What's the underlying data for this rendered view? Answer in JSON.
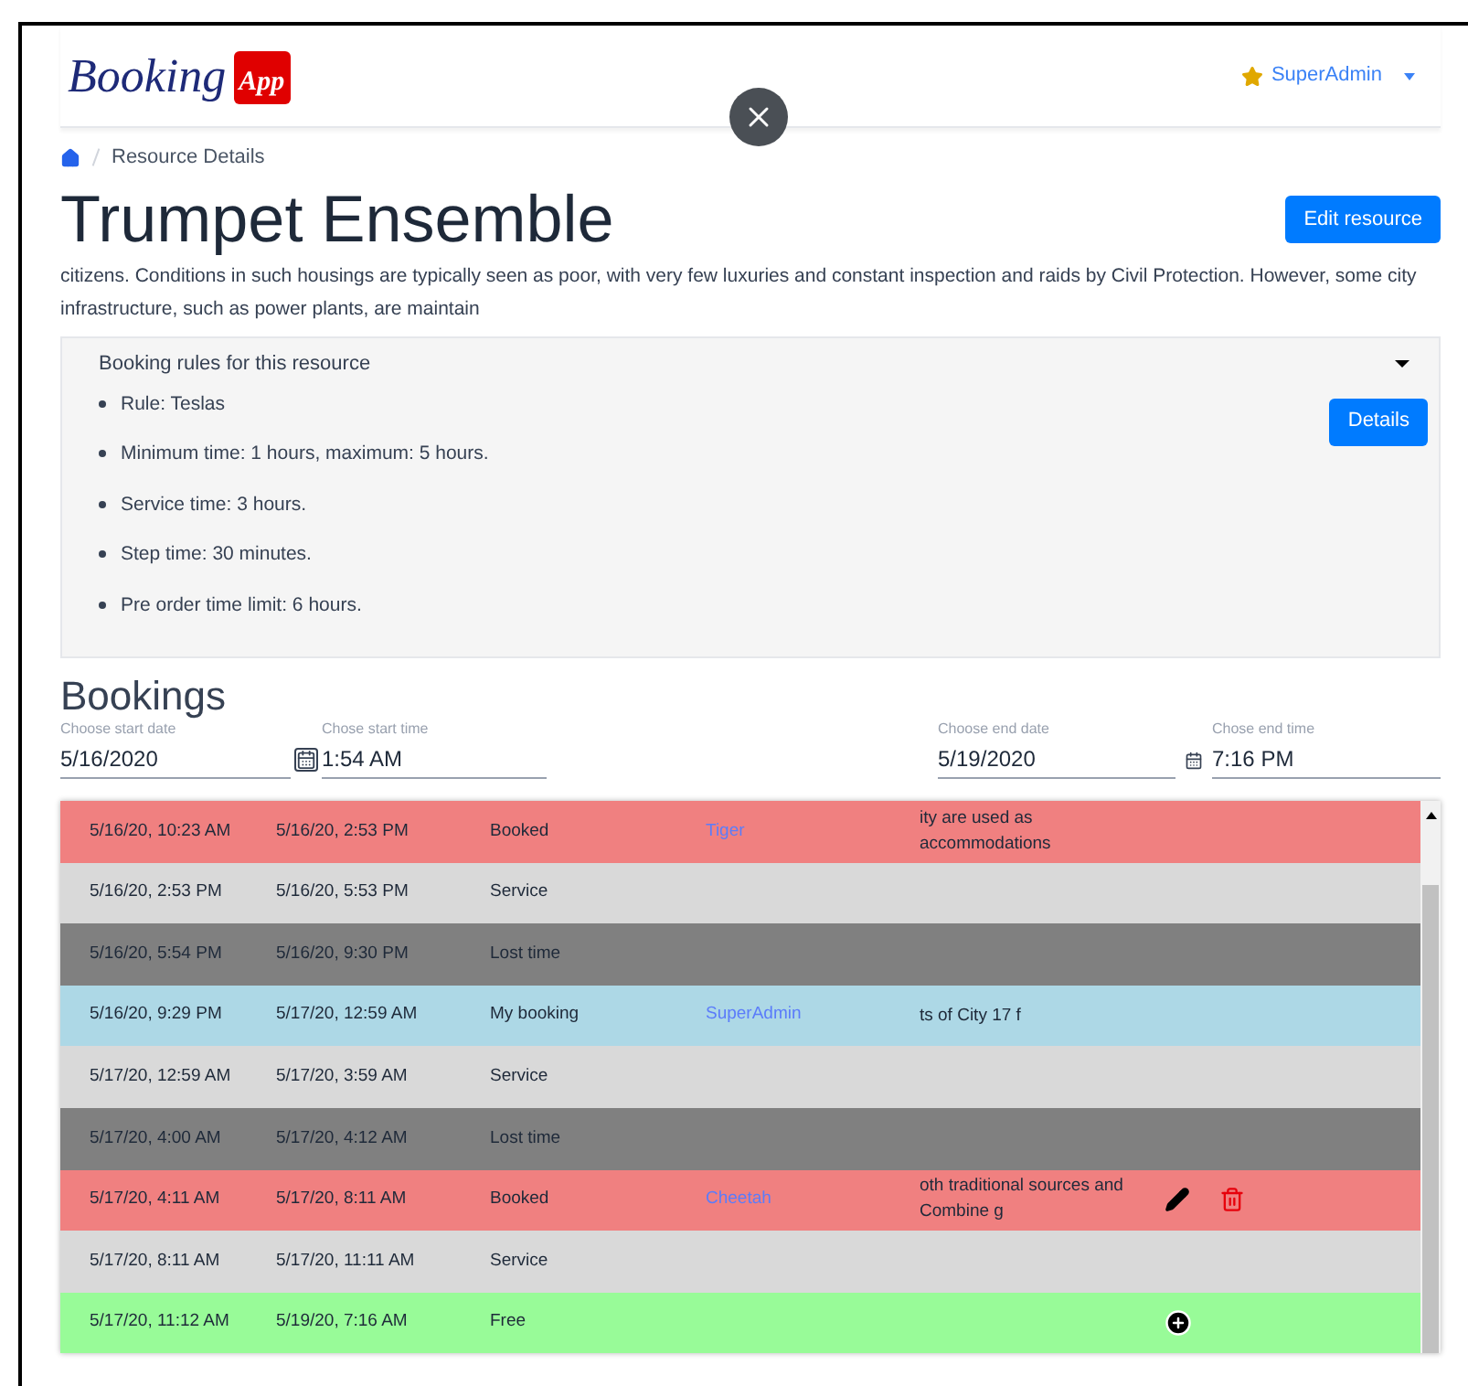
{
  "brand": {
    "word": "Booking",
    "badge": "App"
  },
  "user_menu": {
    "label": "SuperAdmin"
  },
  "breadcrumb": {
    "current": "Resource Details"
  },
  "title": "Trumpet Ensemble",
  "edit_button": "Edit resource",
  "description": "citizens. Conditions in such housings are typically seen as poor, with very few luxuries and constant inspection and raids by Civil Protection. However, some city infrastructure, such as power plants, are maintain",
  "rules": {
    "heading": "Booking rules for this resource",
    "expanded": true,
    "button": "Details",
    "items": [
      "Rule: Teslas",
      "Minimum time: 1 hours, maximum: 5 hours.",
      "Service time: 3 hours.",
      "Step time: 30 minutes.",
      "Pre order time limit: 6 hours."
    ]
  },
  "bookings": {
    "heading": "Bookings",
    "start_date": {
      "label": "Choose start date",
      "value": "5/16/2020"
    },
    "start_time": {
      "label": "Chose start time",
      "value": "1:54 AM"
    },
    "end_date": {
      "label": "Choose end date",
      "value": "5/19/2020"
    },
    "end_time": {
      "label": "Chose end time",
      "value": "7:16 PM"
    },
    "rows": [
      {
        "kind": "booked",
        "start": "5/16/20, 10:23 AM",
        "end": "5/16/20, 2:53 PM",
        "status": "Booked",
        "user": "Tiger",
        "note": "ity are used as accommodations",
        "editable": false,
        "deletable": false,
        "addable": false
      },
      {
        "kind": "service",
        "start": "5/16/20, 2:53 PM",
        "end": "5/16/20, 5:53 PM",
        "status": "Service",
        "editable": false,
        "deletable": false,
        "addable": false
      },
      {
        "kind": "lost",
        "start": "5/16/20, 5:54 PM",
        "end": "5/16/20, 9:30 PM",
        "status": "Lost time",
        "editable": false,
        "deletable": false,
        "addable": false
      },
      {
        "kind": "mine",
        "start": "5/16/20, 9:29 PM",
        "end": "5/17/20, 12:59 AM",
        "status": "My booking",
        "user": "SuperAdmin",
        "note": "ts of City 17 f",
        "editable": false,
        "deletable": false,
        "addable": false
      },
      {
        "kind": "service",
        "start": "5/17/20, 12:59 AM",
        "end": "5/17/20, 3:59 AM",
        "status": "Service",
        "editable": false,
        "deletable": false,
        "addable": false
      },
      {
        "kind": "lost",
        "start": "5/17/20, 4:00 AM",
        "end": "5/17/20, 4:12 AM",
        "status": "Lost time",
        "editable": false,
        "deletable": false,
        "addable": false
      },
      {
        "kind": "booked",
        "start": "5/17/20, 4:11 AM",
        "end": "5/17/20, 8:11 AM",
        "status": "Booked",
        "user": "Cheetah",
        "note": "oth traditional sources and Combine g",
        "editable": true,
        "deletable": true,
        "addable": false
      },
      {
        "kind": "service",
        "start": "5/17/20, 8:11 AM",
        "end": "5/17/20, 11:11 AM",
        "status": "Service",
        "editable": false,
        "deletable": false,
        "addable": false
      },
      {
        "kind": "free",
        "start": "5/17/20, 11:12 AM",
        "end": "5/19/20, 7:16 AM",
        "status": "Free",
        "editable": false,
        "deletable": false,
        "addable": true
      }
    ]
  }
}
